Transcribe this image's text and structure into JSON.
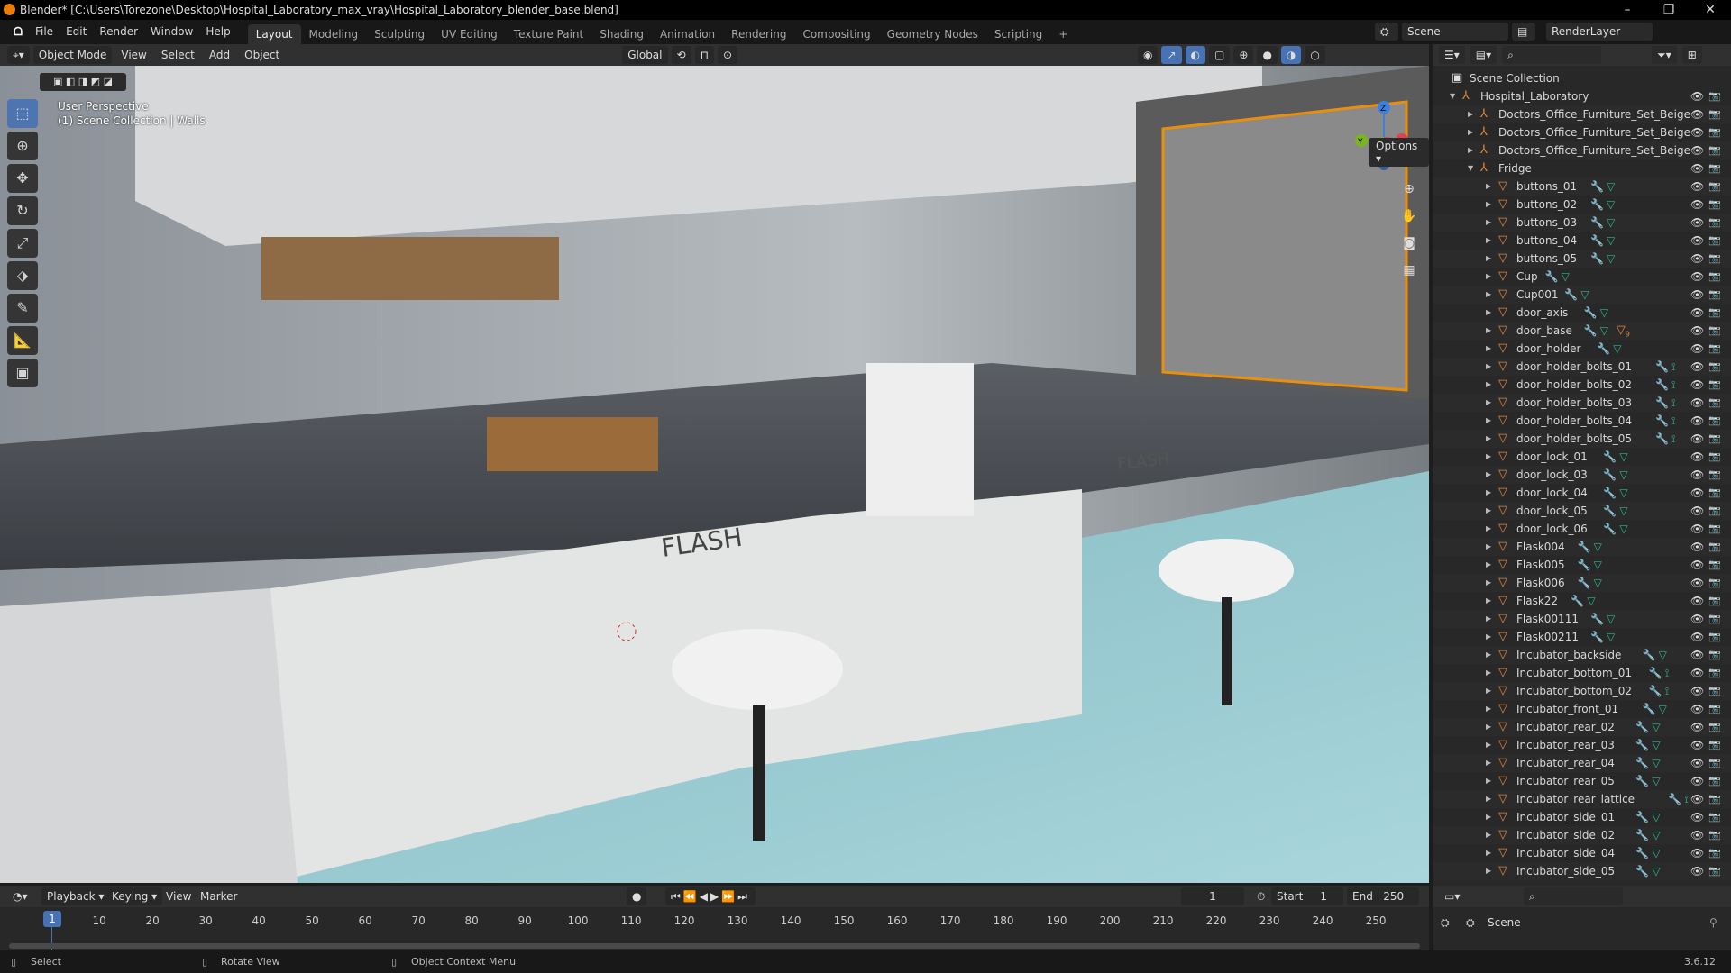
{
  "window": {
    "title": "Blender* [C:\\Users\\Torezone\\Desktop\\Hospital_Laboratory_max_vray\\Hospital_Laboratory_blender_base.blend]",
    "minimize": "–",
    "maximize": "❐",
    "close": "✕"
  },
  "menu": {
    "items": [
      "File",
      "Edit",
      "Render",
      "Window",
      "Help"
    ]
  },
  "workspaces": {
    "tabs": [
      "Layout",
      "Modeling",
      "Sculpting",
      "UV Editing",
      "Texture Paint",
      "Shading",
      "Animation",
      "Rendering",
      "Compositing",
      "Geometry Nodes",
      "Scripting"
    ],
    "active": "Layout",
    "add": "+"
  },
  "scene": {
    "name": "Scene",
    "view_layer": "RenderLayer"
  },
  "viewport_header": {
    "mode": "Object Mode",
    "view": "View",
    "select": "Select",
    "add": "Add",
    "object": "Object",
    "orientation": "Global",
    "options": "Options"
  },
  "viewport": {
    "perspective": "User Perspective",
    "context": "(1) Scene Collection | Walls",
    "label_flash_1": "FLASH",
    "label_flash_2": "FLASH",
    "gizmo": {
      "x": "X",
      "y": "Y",
      "z": "Z"
    }
  },
  "tools": [
    "select-box",
    "cursor",
    "move",
    "rotate",
    "scale",
    "transform",
    "annotate",
    "measure",
    "add-cube"
  ],
  "outliner": {
    "root": "Scene Collection",
    "rows": [
      {
        "name": "Hospital_Laboratory",
        "depth": 0,
        "type": "collection",
        "open": true
      },
      {
        "name": "Doctors_Office_Furniture_Set_Beige",
        "depth": 1,
        "type": "collection"
      },
      {
        "name": "Doctors_Office_Furniture_Set_Beige",
        "depth": 1,
        "type": "collection"
      },
      {
        "name": "Doctors_Office_Furniture_Set_Beige",
        "depth": 1,
        "type": "collection"
      },
      {
        "name": "Fridge",
        "depth": 1,
        "type": "collection",
        "open": true
      },
      {
        "name": "buttons_01",
        "depth": 2,
        "type": "mesh",
        "data": "mesh"
      },
      {
        "name": "buttons_02",
        "depth": 2,
        "type": "mesh",
        "data": "mesh"
      },
      {
        "name": "buttons_03",
        "depth": 2,
        "type": "mesh",
        "data": "mesh"
      },
      {
        "name": "buttons_04",
        "depth": 2,
        "type": "mesh",
        "data": "mesh"
      },
      {
        "name": "buttons_05",
        "depth": 2,
        "type": "mesh",
        "data": "mesh"
      },
      {
        "name": "Cup",
        "depth": 2,
        "type": "mesh",
        "data": "mesh"
      },
      {
        "name": "Cup001",
        "depth": 2,
        "type": "mesh",
        "data": "mesh"
      },
      {
        "name": "door_axis",
        "depth": 2,
        "type": "mesh",
        "data": "mesh"
      },
      {
        "name": "door_base",
        "depth": 2,
        "type": "mesh",
        "data": "mesh",
        "children": "9"
      },
      {
        "name": "door_holder",
        "depth": 2,
        "type": "mesh",
        "data": "mesh"
      },
      {
        "name": "door_holder_bolts_01",
        "depth": 2,
        "type": "mesh",
        "data": "vertex"
      },
      {
        "name": "door_holder_bolts_02",
        "depth": 2,
        "type": "mesh",
        "data": "vertex"
      },
      {
        "name": "door_holder_bolts_03",
        "depth": 2,
        "type": "mesh",
        "data": "vertex"
      },
      {
        "name": "door_holder_bolts_04",
        "depth": 2,
        "type": "mesh",
        "data": "vertex"
      },
      {
        "name": "door_holder_bolts_05",
        "depth": 2,
        "type": "mesh",
        "data": "vertex"
      },
      {
        "name": "door_lock_01",
        "depth": 2,
        "type": "mesh",
        "data": "mesh"
      },
      {
        "name": "door_lock_03",
        "depth": 2,
        "type": "mesh",
        "data": "mesh"
      },
      {
        "name": "door_lock_04",
        "depth": 2,
        "type": "mesh",
        "data": "mesh"
      },
      {
        "name": "door_lock_05",
        "depth": 2,
        "type": "mesh",
        "data": "mesh"
      },
      {
        "name": "door_lock_06",
        "depth": 2,
        "type": "mesh",
        "data": "mesh"
      },
      {
        "name": "Flask004",
        "depth": 2,
        "type": "mesh",
        "data": "mesh"
      },
      {
        "name": "Flask005",
        "depth": 2,
        "type": "mesh",
        "data": "mesh"
      },
      {
        "name": "Flask006",
        "depth": 2,
        "type": "mesh",
        "data": "mesh"
      },
      {
        "name": "Flask22",
        "depth": 2,
        "type": "mesh",
        "data": "mesh"
      },
      {
        "name": "Flask00111",
        "depth": 2,
        "type": "mesh",
        "data": "mesh"
      },
      {
        "name": "Flask00211",
        "depth": 2,
        "type": "mesh",
        "data": "mesh"
      },
      {
        "name": "Incubator_backside",
        "depth": 2,
        "type": "mesh",
        "data": "mesh"
      },
      {
        "name": "Incubator_bottom_01",
        "depth": 2,
        "type": "mesh",
        "data": "vertex"
      },
      {
        "name": "Incubator_bottom_02",
        "depth": 2,
        "type": "mesh",
        "data": "vertex"
      },
      {
        "name": "Incubator_front_01",
        "depth": 2,
        "type": "mesh",
        "data": "mesh"
      },
      {
        "name": "Incubator_rear_02",
        "depth": 2,
        "type": "mesh",
        "data": "mesh"
      },
      {
        "name": "Incubator_rear_03",
        "depth": 2,
        "type": "mesh",
        "data": "mesh"
      },
      {
        "name": "Incubator_rear_04",
        "depth": 2,
        "type": "mesh",
        "data": "mesh"
      },
      {
        "name": "Incubator_rear_05",
        "depth": 2,
        "type": "mesh",
        "data": "mesh"
      },
      {
        "name": "Incubator_rear_lattice",
        "depth": 2,
        "type": "mesh",
        "data": "vertex"
      },
      {
        "name": "Incubator_side_01",
        "depth": 2,
        "type": "mesh",
        "data": "mesh"
      },
      {
        "name": "Incubator_side_02",
        "depth": 2,
        "type": "mesh",
        "data": "mesh"
      },
      {
        "name": "Incubator_side_04",
        "depth": 2,
        "type": "mesh",
        "data": "mesh"
      },
      {
        "name": "Incubator_side_05",
        "depth": 2,
        "type": "mesh",
        "data": "mesh"
      }
    ]
  },
  "timeline": {
    "playback": "Playback",
    "keying": "Keying",
    "view": "View",
    "marker": "Marker",
    "current_frame": "1",
    "start_label": "Start",
    "start": "1",
    "end_label": "End",
    "end": "250",
    "ticks": [
      10,
      20,
      30,
      40,
      50,
      60,
      70,
      80,
      90,
      100,
      110,
      120,
      130,
      140,
      150,
      160,
      170,
      180,
      190,
      200,
      210,
      220,
      230,
      240,
      250
    ]
  },
  "properties": {
    "scene": "Scene"
  },
  "statusbar": {
    "select": "Select",
    "rotate": "Rotate View",
    "context_menu": "Object Context Menu",
    "version": "3.6.12"
  },
  "colors": {
    "accent": "#4772b3",
    "object_orange": "#e0883a",
    "mesh_green": "#29b888",
    "modifier_blue": "#6d8fd6",
    "floor": "#8fc4cc"
  }
}
